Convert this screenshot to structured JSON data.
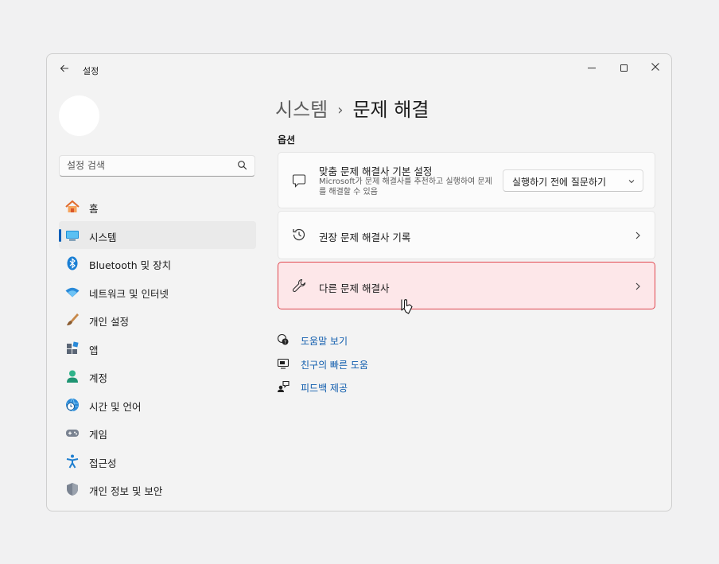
{
  "app": {
    "title": "설정"
  },
  "search": {
    "placeholder": "설정 검색"
  },
  "nav": [
    {
      "label": "홈",
      "icon": "home-icon"
    },
    {
      "label": "시스템",
      "icon": "system-monitor-icon",
      "active": true
    },
    {
      "label": "Bluetooth 및 장치",
      "icon": "bluetooth-icon"
    },
    {
      "label": "네트워크 및 인터넷",
      "icon": "wifi-icon"
    },
    {
      "label": "개인 설정",
      "icon": "brush-icon"
    },
    {
      "label": "앱",
      "icon": "apps-icon"
    },
    {
      "label": "계정",
      "icon": "account-icon"
    },
    {
      "label": "시간 및 언어",
      "icon": "globe-clock-icon"
    },
    {
      "label": "게임",
      "icon": "gamepad-icon"
    },
    {
      "label": "접근성",
      "icon": "accessibility-icon"
    },
    {
      "label": "개인 정보 및 보안",
      "icon": "shield-icon"
    }
  ],
  "breadcrumb": {
    "parent": "시스템",
    "separator": "›",
    "current": "문제 해결"
  },
  "section": {
    "title": "옵션"
  },
  "cards": {
    "preferences": {
      "title": "맞춤 문제 해결사 기본 설정",
      "description": "Microsoft가 문제 해결사를 추천하고 실행하여 문제를 해결할 수 있음",
      "dropdown_value": "실행하기 전에 질문하기"
    },
    "history": {
      "title": "권장 문제 해결사 기록"
    },
    "other": {
      "title": "다른 문제 해결사"
    }
  },
  "links": [
    {
      "label": "도움말 보기"
    },
    {
      "label": "친구의 빠른 도움"
    },
    {
      "label": "피드백 제공"
    }
  ],
  "colors": {
    "accent": "#005fb8",
    "highlight_fill": "#fde7e9",
    "highlight_border": "#e0464e",
    "link": "#0f5cad"
  }
}
